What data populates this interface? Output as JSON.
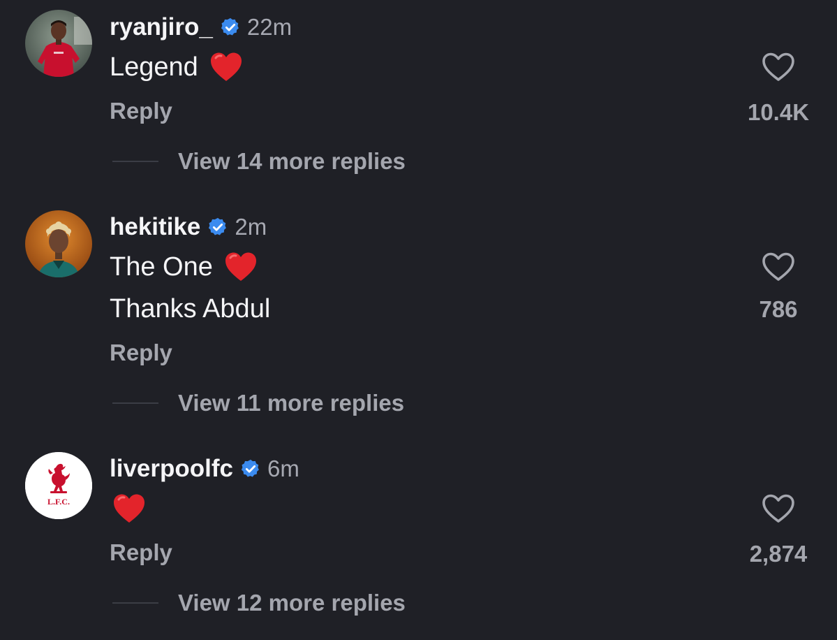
{
  "theme": {
    "background": "#1f2026",
    "verified_color": "#3b8bef",
    "heart_emoji_color": "#e3242b",
    "liverpool_red": "#c8102e"
  },
  "comments": [
    {
      "username": "ryanjiro_",
      "verified": true,
      "time": "22m",
      "lines": [
        "Legend"
      ],
      "emoji": "red-heart",
      "reply_label": "Reply",
      "like_icon": "heart-outline-icon",
      "like_count": "10.4K",
      "view_replies": "View 14 more replies",
      "avatar": "profile-photo"
    },
    {
      "username": "hekitike",
      "verified": true,
      "time": "2m",
      "lines": [
        "The One",
        "Thanks Abdul"
      ],
      "emoji": "red-heart",
      "reply_label": "Reply",
      "like_icon": "heart-outline-icon",
      "like_count": "786",
      "view_replies": "View 11 more replies",
      "avatar": "profile-photo"
    },
    {
      "username": "liverpoolfc",
      "verified": true,
      "time": "6m",
      "lines": [
        ""
      ],
      "emoji": "red-heart",
      "reply_label": "Reply",
      "like_icon": "heart-outline-icon",
      "like_count": "2,874",
      "view_replies": "View 12 more replies",
      "avatar": "club-crest-logo",
      "crest_text": "L.F.C."
    }
  ]
}
